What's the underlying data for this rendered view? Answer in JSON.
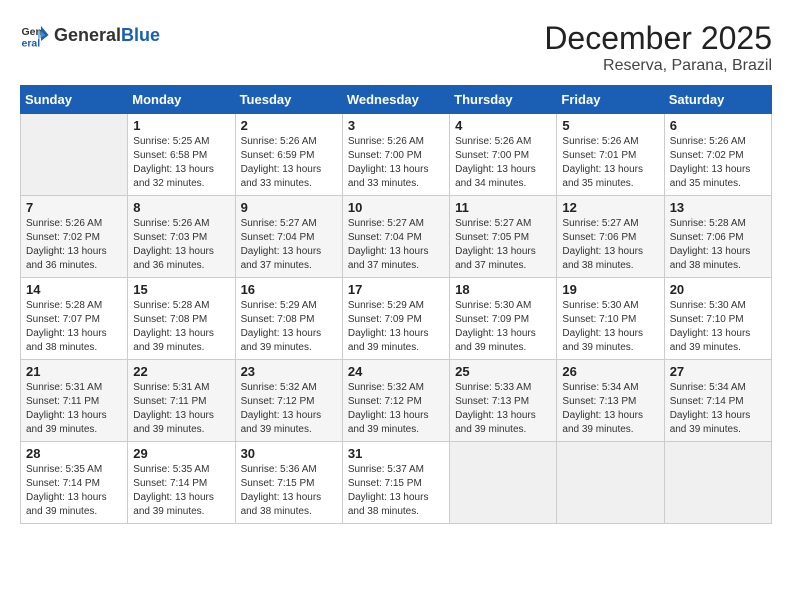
{
  "header": {
    "logo_text_general": "General",
    "logo_text_blue": "Blue",
    "month_title": "December 2025",
    "location": "Reserva, Parana, Brazil"
  },
  "weekdays": [
    "Sunday",
    "Monday",
    "Tuesday",
    "Wednesday",
    "Thursday",
    "Friday",
    "Saturday"
  ],
  "weeks": [
    [
      {
        "day": "",
        "empty": true
      },
      {
        "day": "1",
        "sunrise": "Sunrise: 5:25 AM",
        "sunset": "Sunset: 6:58 PM",
        "daylight": "Daylight: 13 hours and 32 minutes."
      },
      {
        "day": "2",
        "sunrise": "Sunrise: 5:26 AM",
        "sunset": "Sunset: 6:59 PM",
        "daylight": "Daylight: 13 hours and 33 minutes."
      },
      {
        "day": "3",
        "sunrise": "Sunrise: 5:26 AM",
        "sunset": "Sunset: 7:00 PM",
        "daylight": "Daylight: 13 hours and 33 minutes."
      },
      {
        "day": "4",
        "sunrise": "Sunrise: 5:26 AM",
        "sunset": "Sunset: 7:00 PM",
        "daylight": "Daylight: 13 hours and 34 minutes."
      },
      {
        "day": "5",
        "sunrise": "Sunrise: 5:26 AM",
        "sunset": "Sunset: 7:01 PM",
        "daylight": "Daylight: 13 hours and 35 minutes."
      },
      {
        "day": "6",
        "sunrise": "Sunrise: 5:26 AM",
        "sunset": "Sunset: 7:02 PM",
        "daylight": "Daylight: 13 hours and 35 minutes."
      }
    ],
    [
      {
        "day": "7",
        "sunrise": "Sunrise: 5:26 AM",
        "sunset": "Sunset: 7:02 PM",
        "daylight": "Daylight: 13 hours and 36 minutes."
      },
      {
        "day": "8",
        "sunrise": "Sunrise: 5:26 AM",
        "sunset": "Sunset: 7:03 PM",
        "daylight": "Daylight: 13 hours and 36 minutes."
      },
      {
        "day": "9",
        "sunrise": "Sunrise: 5:27 AM",
        "sunset": "Sunset: 7:04 PM",
        "daylight": "Daylight: 13 hours and 37 minutes."
      },
      {
        "day": "10",
        "sunrise": "Sunrise: 5:27 AM",
        "sunset": "Sunset: 7:04 PM",
        "daylight": "Daylight: 13 hours and 37 minutes."
      },
      {
        "day": "11",
        "sunrise": "Sunrise: 5:27 AM",
        "sunset": "Sunset: 7:05 PM",
        "daylight": "Daylight: 13 hours and 37 minutes."
      },
      {
        "day": "12",
        "sunrise": "Sunrise: 5:27 AM",
        "sunset": "Sunset: 7:06 PM",
        "daylight": "Daylight: 13 hours and 38 minutes."
      },
      {
        "day": "13",
        "sunrise": "Sunrise: 5:28 AM",
        "sunset": "Sunset: 7:06 PM",
        "daylight": "Daylight: 13 hours and 38 minutes."
      }
    ],
    [
      {
        "day": "14",
        "sunrise": "Sunrise: 5:28 AM",
        "sunset": "Sunset: 7:07 PM",
        "daylight": "Daylight: 13 hours and 38 minutes."
      },
      {
        "day": "15",
        "sunrise": "Sunrise: 5:28 AM",
        "sunset": "Sunset: 7:08 PM",
        "daylight": "Daylight: 13 hours and 39 minutes."
      },
      {
        "day": "16",
        "sunrise": "Sunrise: 5:29 AM",
        "sunset": "Sunset: 7:08 PM",
        "daylight": "Daylight: 13 hours and 39 minutes."
      },
      {
        "day": "17",
        "sunrise": "Sunrise: 5:29 AM",
        "sunset": "Sunset: 7:09 PM",
        "daylight": "Daylight: 13 hours and 39 minutes."
      },
      {
        "day": "18",
        "sunrise": "Sunrise: 5:30 AM",
        "sunset": "Sunset: 7:09 PM",
        "daylight": "Daylight: 13 hours and 39 minutes."
      },
      {
        "day": "19",
        "sunrise": "Sunrise: 5:30 AM",
        "sunset": "Sunset: 7:10 PM",
        "daylight": "Daylight: 13 hours and 39 minutes."
      },
      {
        "day": "20",
        "sunrise": "Sunrise: 5:30 AM",
        "sunset": "Sunset: 7:10 PM",
        "daylight": "Daylight: 13 hours and 39 minutes."
      }
    ],
    [
      {
        "day": "21",
        "sunrise": "Sunrise: 5:31 AM",
        "sunset": "Sunset: 7:11 PM",
        "daylight": "Daylight: 13 hours and 39 minutes."
      },
      {
        "day": "22",
        "sunrise": "Sunrise: 5:31 AM",
        "sunset": "Sunset: 7:11 PM",
        "daylight": "Daylight: 13 hours and 39 minutes."
      },
      {
        "day": "23",
        "sunrise": "Sunrise: 5:32 AM",
        "sunset": "Sunset: 7:12 PM",
        "daylight": "Daylight: 13 hours and 39 minutes."
      },
      {
        "day": "24",
        "sunrise": "Sunrise: 5:32 AM",
        "sunset": "Sunset: 7:12 PM",
        "daylight": "Daylight: 13 hours and 39 minutes."
      },
      {
        "day": "25",
        "sunrise": "Sunrise: 5:33 AM",
        "sunset": "Sunset: 7:13 PM",
        "daylight": "Daylight: 13 hours and 39 minutes."
      },
      {
        "day": "26",
        "sunrise": "Sunrise: 5:34 AM",
        "sunset": "Sunset: 7:13 PM",
        "daylight": "Daylight: 13 hours and 39 minutes."
      },
      {
        "day": "27",
        "sunrise": "Sunrise: 5:34 AM",
        "sunset": "Sunset: 7:14 PM",
        "daylight": "Daylight: 13 hours and 39 minutes."
      }
    ],
    [
      {
        "day": "28",
        "sunrise": "Sunrise: 5:35 AM",
        "sunset": "Sunset: 7:14 PM",
        "daylight": "Daylight: 13 hours and 39 minutes."
      },
      {
        "day": "29",
        "sunrise": "Sunrise: 5:35 AM",
        "sunset": "Sunset: 7:14 PM",
        "daylight": "Daylight: 13 hours and 39 minutes."
      },
      {
        "day": "30",
        "sunrise": "Sunrise: 5:36 AM",
        "sunset": "Sunset: 7:15 PM",
        "daylight": "Daylight: 13 hours and 38 minutes."
      },
      {
        "day": "31",
        "sunrise": "Sunrise: 5:37 AM",
        "sunset": "Sunset: 7:15 PM",
        "daylight": "Daylight: 13 hours and 38 minutes."
      },
      {
        "day": "",
        "empty": true
      },
      {
        "day": "",
        "empty": true
      },
      {
        "day": "",
        "empty": true
      }
    ]
  ]
}
